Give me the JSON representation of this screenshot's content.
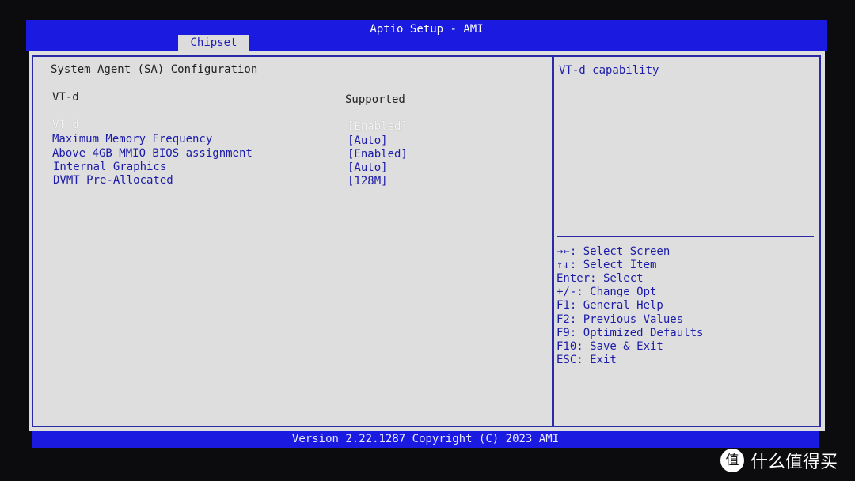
{
  "header": {
    "title": "Aptio Setup - AMI",
    "active_tab": "Chipset"
  },
  "main": {
    "section_title": "System Agent (SA) Configuration",
    "info": {
      "label": "VT-d",
      "value": "Supported"
    },
    "items": [
      {
        "label": "VT-d",
        "value": "[Enabled]",
        "state": "disabled"
      },
      {
        "label": "Maximum Memory Frequency",
        "value": "[Auto]"
      },
      {
        "label": "Above 4GB MMIO BIOS assignment",
        "value": "[Enabled]"
      },
      {
        "label": "Internal Graphics",
        "value": "[Auto]"
      },
      {
        "label": "DVMT Pre-Allocated",
        "value": "[128M]"
      }
    ]
  },
  "help": {
    "description": "VT-d capability",
    "keys": [
      "→←: Select Screen",
      "↑↓: Select Item",
      "Enter: Select",
      "+/-: Change Opt",
      "F1: General Help",
      "F2: Previous Values",
      "F9: Optimized Defaults",
      "F10: Save & Exit",
      "ESC: Exit"
    ]
  },
  "footer": {
    "text": "Version 2.22.1287 Copyright (C) 2023 AMI"
  },
  "watermark": {
    "logo": "值",
    "text": "什么值得买"
  },
  "colors": {
    "bios_blue": "#1a1ae0",
    "panel_gray": "#dedede",
    "text_blue": "#1c1ca8"
  }
}
